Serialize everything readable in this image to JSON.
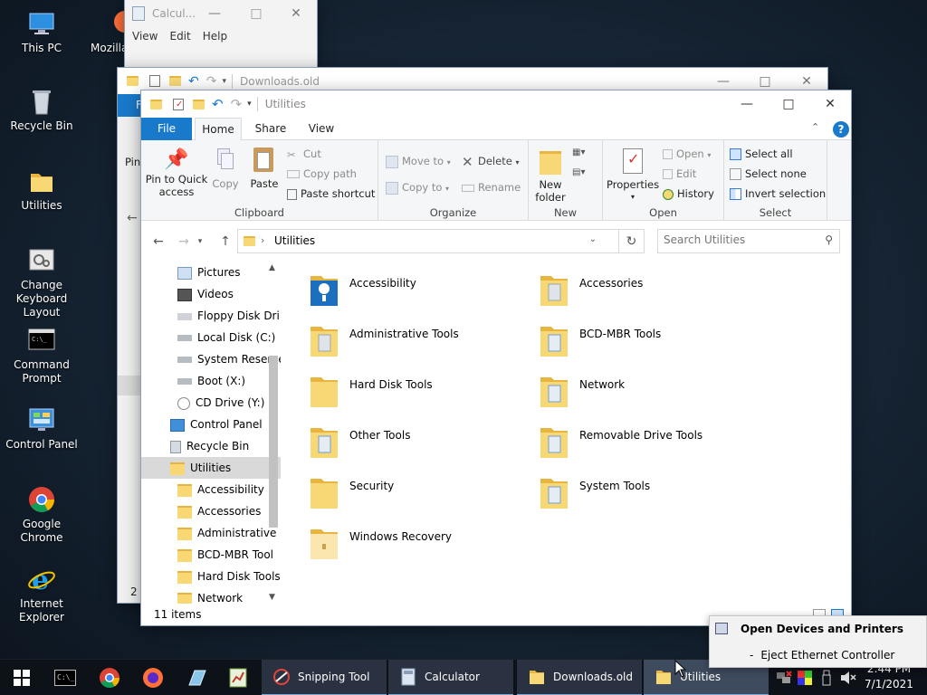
{
  "desktop": {
    "icons": [
      {
        "label": "This PC",
        "icon": "this-pc-icon"
      },
      {
        "label": "Recycle Bin",
        "icon": "recycle-bin-icon"
      },
      {
        "label": "Utilities",
        "icon": "folder-icon"
      },
      {
        "label": "Change Keyboard Layout",
        "line1": "Change",
        "line2": "Keyboard Layout",
        "icon": "keyboard-layout-icon"
      },
      {
        "label": "Command Prompt",
        "line1": "Command",
        "line2": "Prompt",
        "icon": "command-prompt-icon"
      },
      {
        "label": "Control Panel",
        "icon": "control-panel-icon"
      },
      {
        "label": "Google Chrome",
        "icon": "chrome-icon"
      },
      {
        "label": "Internet Explorer",
        "icon": "internet-explorer-icon"
      },
      {
        "label": "Mozilla",
        "icon": "firefox-icon"
      }
    ]
  },
  "calculator_window": {
    "title": "Calcul...",
    "menu": [
      "View",
      "Edit",
      "Help"
    ]
  },
  "downloads_window": {
    "title": "Downloads.old",
    "tab_fragment": "F",
    "pin_fragment": "Pin",
    "footer_fragment": "2 i"
  },
  "explorer": {
    "title": "Utilities",
    "tabs": {
      "file": "File",
      "home": "Home",
      "share": "Share",
      "view": "View"
    },
    "help": "?",
    "ribbon": {
      "clipboard": {
        "pin_line1": "Pin to Quick",
        "pin_line2": "access",
        "copy": "Copy",
        "paste": "Paste",
        "cut": "Cut",
        "copy_path": "Copy path",
        "paste_shortcut": "Paste shortcut",
        "group": "Clipboard"
      },
      "organize": {
        "move_to": "Move to",
        "copy_to": "Copy to",
        "delete": "Delete",
        "rename": "Rename",
        "group": "Organize"
      },
      "new": {
        "line1": "New",
        "line2": "folder",
        "group": "New"
      },
      "open": {
        "properties": "Properties",
        "open": "Open",
        "edit": "Edit",
        "history": "History",
        "group": "Open"
      },
      "select": {
        "select_all": "Select all",
        "select_none": "Select none",
        "invert": "Invert selection",
        "group": "Select"
      }
    },
    "address": {
      "path": "Utilities",
      "search_placeholder": "Search Utilities"
    },
    "tree": [
      {
        "label": "Pictures",
        "icon": "pictures-icon",
        "indent": 2
      },
      {
        "label": "Videos",
        "icon": "videos-icon",
        "indent": 2
      },
      {
        "label": "Floppy Disk Dri",
        "icon": "floppy-drive-icon",
        "indent": 2
      },
      {
        "label": "Local Disk (C:)",
        "icon": "drive-icon",
        "indent": 2
      },
      {
        "label": "System Reserve",
        "icon": "drive-icon",
        "indent": 2
      },
      {
        "label": "Boot (X:)",
        "icon": "drive-icon",
        "indent": 2
      },
      {
        "label": "CD Drive (Y:)",
        "icon": "cd-drive-icon",
        "indent": 2
      },
      {
        "label": "Control Panel",
        "icon": "control-panel-icon",
        "indent": 1
      },
      {
        "label": "Recycle Bin",
        "icon": "recycle-bin-icon",
        "indent": 1
      },
      {
        "label": "Utilities",
        "icon": "folder-icon",
        "indent": 1,
        "selected": true
      },
      {
        "label": "Accessibility",
        "icon": "folder-icon",
        "indent": 2
      },
      {
        "label": "Accessories",
        "icon": "folder-icon",
        "indent": 2
      },
      {
        "label": "Administrative",
        "icon": "folder-icon",
        "indent": 2
      },
      {
        "label": "BCD-MBR Tool",
        "icon": "folder-icon",
        "indent": 2
      },
      {
        "label": "Hard Disk Tools",
        "icon": "folder-icon",
        "indent": 2
      },
      {
        "label": "Network",
        "icon": "folder-icon",
        "indent": 2
      }
    ],
    "items": [
      {
        "label": "Accessibility",
        "icon": "accessibility-folder-icon"
      },
      {
        "label": "Accessories",
        "icon": "folder-icon"
      },
      {
        "label": "Administrative Tools",
        "icon": "folder-icon"
      },
      {
        "label": "BCD-MBR Tools",
        "icon": "folder-icon"
      },
      {
        "label": "Hard Disk Tools",
        "icon": "folder-icon"
      },
      {
        "label": "Network",
        "icon": "folder-icon"
      },
      {
        "label": "Other Tools",
        "icon": "folder-icon"
      },
      {
        "label": "Removable Drive Tools",
        "icon": "folder-icon"
      },
      {
        "label": "Security",
        "icon": "folder-icon"
      },
      {
        "label": "System Tools",
        "icon": "folder-icon"
      },
      {
        "label": "Windows Recovery",
        "icon": "folder-icon"
      }
    ],
    "status": "11 items"
  },
  "taskbar": {
    "apps": [
      {
        "label": "Snipping Tool",
        "icon": "snipping-tool-icon"
      },
      {
        "label": "Calculator",
        "icon": "calculator-icon"
      },
      {
        "label": "Downloads.old",
        "icon": "folder-icon"
      },
      {
        "label": "Utilities",
        "icon": "folder-icon"
      }
    ],
    "clock": {
      "time": "2:44 PM",
      "date": "7/1/2021"
    }
  },
  "popup": {
    "title": "Open Devices and Printers",
    "item": "Eject Ethernet Controller",
    "bullet": "-"
  },
  "colors": {
    "accent": "#1979ca",
    "file_tab": "#1979ca",
    "folder": "#f8d775",
    "selection": "#d9d9d9"
  }
}
